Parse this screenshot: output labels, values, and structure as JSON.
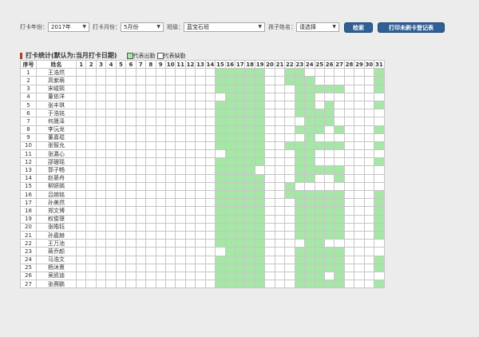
{
  "filters": {
    "year_label": "打卡年份：",
    "year_value": "2017年",
    "month_label": "打卡月份：",
    "month_value": "5月份",
    "class_label": "班级：",
    "class_value": "蓝宝石班",
    "child_label": "孩子姓名：",
    "child_value": "请选择",
    "search_button": "检索",
    "print_button": "打印未刷卡登记表"
  },
  "section_title": "打卡统计(默认为:当月打卡日期)",
  "legend": {
    "present_label": "代表出勤",
    "absent_label": "代表缺勤",
    "present_color": "#a6e6a6",
    "absent_color": "#ffffff"
  },
  "table": {
    "header_index": "序号",
    "header_name": "姓名",
    "days": [
      "1",
      "2",
      "3",
      "4",
      "5",
      "6",
      "7",
      "8",
      "9",
      "10",
      "11",
      "12",
      "13",
      "14",
      "15",
      "16",
      "17",
      "18",
      "19",
      "20",
      "21",
      "22",
      "23",
      "24",
      "25",
      "26",
      "27",
      "28",
      "29",
      "30",
      "31"
    ],
    "rows": [
      {
        "n": "1",
        "name": "王浩然",
        "present": [
          15,
          16,
          17,
          18,
          19,
          22,
          23,
          31
        ]
      },
      {
        "n": "2",
        "name": "高紫萌",
        "present": [
          15,
          16,
          17,
          18,
          19,
          22,
          23,
          24,
          31
        ]
      },
      {
        "n": "3",
        "name": "宋峻熙",
        "present": [
          15,
          16,
          17,
          18,
          19,
          23,
          24,
          25,
          26,
          27,
          31
        ]
      },
      {
        "n": "4",
        "name": "董依洋",
        "present": [
          16,
          17,
          18,
          19,
          23,
          24
        ]
      },
      {
        "n": "5",
        "name": "张丰琪",
        "present": [
          15,
          16,
          17,
          18,
          19,
          23,
          24,
          26,
          31
        ]
      },
      {
        "n": "6",
        "name": "于浩铭",
        "present": [
          15,
          16,
          17,
          18,
          19,
          23,
          24,
          25,
          26
        ]
      },
      {
        "n": "7",
        "name": "何晟泽",
        "present": [
          15,
          16,
          17,
          18,
          19,
          24,
          25,
          26
        ]
      },
      {
        "n": "8",
        "name": "李沅龙",
        "present": [
          15,
          16,
          17,
          18,
          19,
          23,
          24,
          25,
          27,
          31
        ]
      },
      {
        "n": "9",
        "name": "董嘉琨",
        "present": [
          15,
          16,
          17,
          18,
          19,
          24
        ]
      },
      {
        "n": "10",
        "name": "张智允",
        "present": [
          15,
          16,
          17,
          18,
          19,
          22,
          23,
          24,
          25,
          26,
          27,
          31
        ]
      },
      {
        "n": "11",
        "name": "张瀛心",
        "present": [
          16,
          17,
          18,
          19,
          23,
          24
        ]
      },
      {
        "n": "12",
        "name": "邵珊瑶",
        "present": [
          15,
          16,
          17,
          18,
          19,
          23,
          24,
          31
        ]
      },
      {
        "n": "13",
        "name": "郭子畅",
        "present": [
          15,
          16,
          17,
          18,
          23,
          24,
          25,
          26,
          27
        ]
      },
      {
        "n": "14",
        "name": "赵晏舟",
        "present": [
          15,
          16,
          17,
          18,
          19,
          23,
          24,
          27
        ]
      },
      {
        "n": "15",
        "name": "柳妍嫣",
        "present": [
          15,
          16,
          17,
          18,
          19,
          22
        ]
      },
      {
        "n": "16",
        "name": "吕婉铭",
        "present": [
          15,
          16,
          17,
          18,
          19,
          22,
          23,
          24,
          25,
          26,
          27,
          31
        ]
      },
      {
        "n": "17",
        "name": "孙美然",
        "present": [
          15,
          16,
          17,
          18,
          19,
          23,
          24,
          25,
          26,
          27,
          31
        ]
      },
      {
        "n": "18",
        "name": "郑文博",
        "present": [
          15,
          16,
          17,
          18,
          19,
          23,
          24,
          25,
          26,
          27,
          31
        ]
      },
      {
        "n": "19",
        "name": "权俊璟",
        "present": [
          15,
          16,
          17,
          18,
          19,
          23,
          24,
          25,
          26,
          27,
          31
        ]
      },
      {
        "n": "20",
        "name": "张皓钰",
        "present": [
          15,
          16,
          17,
          18,
          19,
          23,
          24,
          25,
          26,
          27,
          31
        ]
      },
      {
        "n": "21",
        "name": "孙嘉赫",
        "present": [
          15,
          16,
          17,
          18,
          19,
          23,
          24,
          25,
          26,
          27,
          31
        ]
      },
      {
        "n": "22",
        "name": "王万池",
        "present": [
          15,
          16,
          17,
          18,
          19,
          24,
          25
        ]
      },
      {
        "n": "23",
        "name": "蒋乔颜",
        "present": [
          16,
          17,
          18,
          19,
          23,
          24,
          25,
          26,
          27
        ]
      },
      {
        "n": "24",
        "name": "马浩文",
        "present": [
          15,
          16,
          17,
          18,
          19,
          23,
          24,
          25,
          26,
          27,
          31
        ]
      },
      {
        "n": "25",
        "name": "杨沐熹",
        "present": [
          15,
          16,
          17,
          18,
          19,
          23,
          24,
          25,
          26,
          27,
          31
        ]
      },
      {
        "n": "26",
        "name": "吴凯迪",
        "present": [
          15,
          16,
          17,
          18,
          19,
          23,
          24,
          25,
          27
        ]
      },
      {
        "n": "27",
        "name": "张赛鹏",
        "present": [
          15,
          16,
          17,
          18,
          19,
          23,
          24,
          25,
          26,
          27,
          31
        ]
      }
    ]
  }
}
